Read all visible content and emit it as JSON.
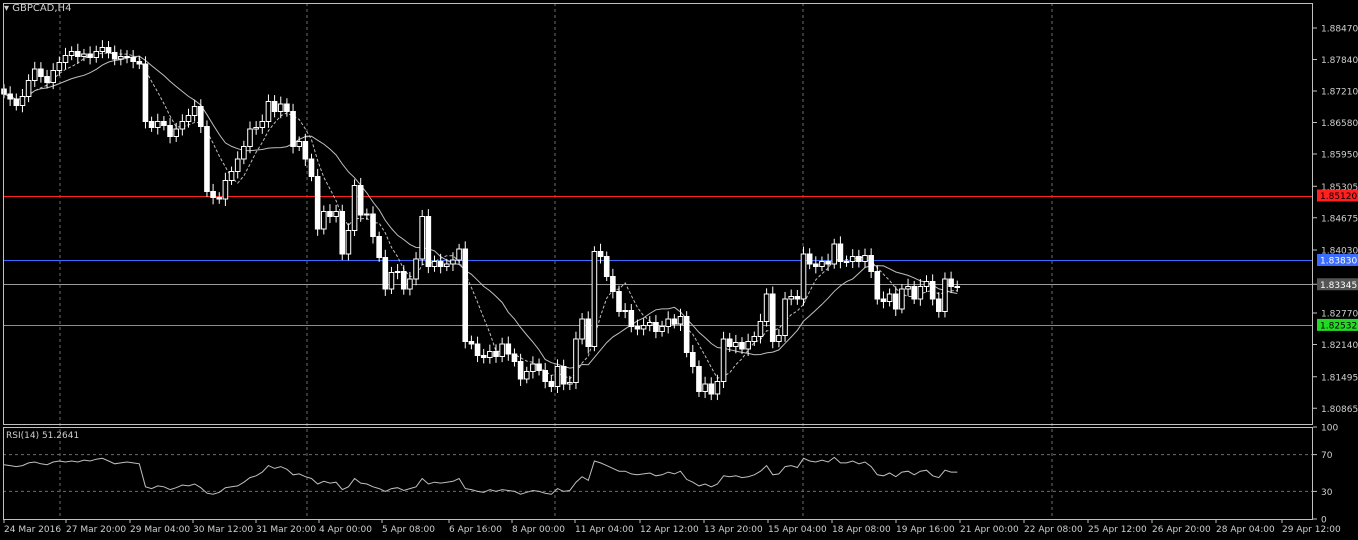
{
  "window": {
    "symbol_title": "GBPCAD,H4",
    "rsi_title": "RSI(14) 51.2641"
  },
  "colors": {
    "background": "#000000",
    "grid": "#6b6b6b",
    "axis": "#c0c0c0",
    "text": "#cfcfcf",
    "bull_candle": "#000000",
    "bear_candle": "#ffffff",
    "wick": "#ffffff",
    "ma": "#bfbfbf",
    "resistance": "#ff2020",
    "pivot": "#3a6cff",
    "support": "#23d923",
    "current": "#9a9a9a"
  },
  "chart_data": {
    "type": "candlestick",
    "timeframe": "H4",
    "y_axis_ticks": [
      "1.88470",
      "1.87840",
      "1.87210",
      "1.86580",
      "1.85950",
      "1.85305",
      "1.84675",
      "1.84030",
      "1.83345",
      "1.82770",
      "1.82140",
      "1.81495",
      "1.80865"
    ],
    "ylim": [
      1.8055,
      1.8897
    ],
    "x_tick_labels": [
      "24 Mar 2016",
      "27 Mar 20:00",
      "29 Mar 04:00",
      "30 Mar 12:00",
      "31 Mar 20:00",
      "4 Apr 00:00",
      "5 Apr 08:00",
      "6 Apr 16:00",
      "8 Apr 00:00",
      "11 Apr 04:00",
      "12 Apr 12:00",
      "13 Apr 20:00",
      "15 Apr 04:00",
      "18 Apr 08:00",
      "19 Apr 16:00",
      "21 Apr 00:00",
      "22 Apr 08:00",
      "25 Apr 12:00",
      "26 Apr 20:00",
      "28 Apr 04:00",
      "29 Apr 12:00"
    ],
    "horizontal_lines": [
      {
        "name": "resistance",
        "value": 1.8512,
        "label": "1.85120"
      },
      {
        "name": "pivot",
        "value": 1.8383,
        "label": "1.83830"
      },
      {
        "name": "current",
        "value": 1.83345,
        "label": "1.83345"
      },
      {
        "name": "support",
        "value": 1.82532,
        "label": "1.82532"
      }
    ],
    "close": [
      1.8715,
      1.8705,
      1.8692,
      1.871,
      1.8742,
      1.8765,
      1.875,
      1.8738,
      1.8762,
      1.8778,
      1.8792,
      1.88,
      1.879,
      1.8795,
      1.8788,
      1.88,
      1.8808,
      1.8798,
      1.8785,
      1.879,
      1.8788,
      1.878,
      1.8775,
      1.866,
      1.8648,
      1.866,
      1.8652,
      1.863,
      1.8645,
      1.866,
      1.8672,
      1.869,
      1.865,
      1.852,
      1.8508,
      1.8505,
      1.8542,
      1.856,
      1.8585,
      1.861,
      1.8645,
      1.8648,
      1.866,
      1.87,
      1.868,
      1.8695,
      1.868,
      1.861,
      1.862,
      1.8585,
      1.855,
      1.8445,
      1.848,
      1.847,
      1.848,
      1.8395,
      1.8442,
      1.8532,
      1.8473,
      1.8475,
      1.843,
      1.8388,
      1.8325,
      1.8358,
      1.836,
      1.8325,
      1.8345,
      1.8385,
      1.847,
      1.837,
      1.838,
      1.837,
      1.8375,
      1.8383,
      1.8405,
      1.822,
      1.8215,
      1.8192,
      1.8188,
      1.82,
      1.819,
      1.8215,
      1.8195,
      1.818,
      1.8145,
      1.816,
      1.8175,
      1.8162,
      1.814,
      1.813,
      1.817,
      1.8135,
      1.8138,
      1.8225,
      1.8265,
      1.821,
      1.84,
      1.839,
      1.835,
      1.832,
      1.828,
      1.8282,
      1.825,
      1.8245,
      1.8252,
      1.8258,
      1.824,
      1.825,
      1.8265,
      1.8255,
      1.827,
      1.8198,
      1.817,
      1.812,
      1.8135,
      1.8115,
      1.814,
      1.8225,
      1.821,
      1.8218,
      1.8205,
      1.822,
      1.823,
      1.826,
      1.8315,
      1.822,
      1.8232,
      1.8305,
      1.831,
      1.8305,
      1.8395,
      1.8375,
      1.837,
      1.838,
      1.8375,
      1.8415,
      1.838,
      1.838,
      1.839,
      1.838,
      1.8392,
      1.836,
      1.8305,
      1.83,
      1.8315,
      1.8285,
      1.8325,
      1.833,
      1.8305,
      1.833,
      1.834,
      1.8305,
      1.828,
      1.8345,
      1.833,
      1.833
    ],
    "rsi": {
      "name": "RSI(14)",
      "last_value": 51.2641,
      "ylim": [
        0,
        100
      ],
      "ticks": [
        100,
        70,
        30,
        0
      ],
      "levels": [
        70,
        30
      ],
      "values": [
        59,
        58,
        57,
        58,
        61,
        62,
        60,
        59,
        62,
        63,
        62,
        63,
        62,
        64,
        63,
        65,
        66,
        63,
        60,
        61,
        62,
        61,
        60,
        35,
        33,
        36,
        35,
        32,
        34,
        37,
        36,
        38,
        34,
        28,
        27,
        29,
        34,
        35,
        36,
        40,
        45,
        47,
        51,
        58,
        55,
        57,
        54,
        48,
        49,
        46,
        44,
        38,
        41,
        39,
        40,
        32,
        35,
        44,
        39,
        38,
        35,
        33,
        30,
        33,
        34,
        31,
        33,
        35,
        44,
        38,
        40,
        39,
        40,
        41,
        44,
        33,
        32,
        30,
        29,
        32,
        30,
        32,
        31,
        30,
        27,
        29,
        31,
        30,
        28,
        27,
        33,
        30,
        31,
        40,
        46,
        42,
        63,
        61,
        58,
        55,
        52,
        52,
        49,
        48,
        49,
        50,
        47,
        48,
        51,
        49,
        52,
        43,
        40,
        36,
        38,
        35,
        38,
        47,
        46,
        47,
        45,
        46,
        48,
        52,
        58,
        48,
        49,
        57,
        58,
        56,
        66,
        63,
        62,
        64,
        62,
        67,
        61,
        61,
        63,
        60,
        62,
        57,
        48,
        47,
        50,
        46,
        51,
        52,
        48,
        52,
        53,
        47,
        45,
        53,
        51,
        51
      ]
    }
  }
}
